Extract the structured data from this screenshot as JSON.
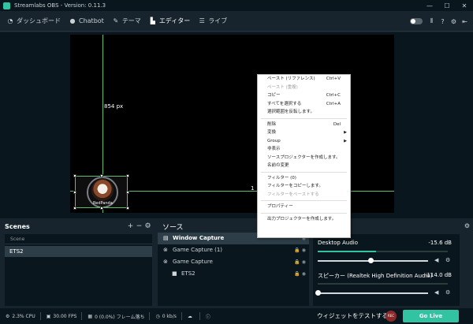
{
  "window": {
    "title": "Streamlabs OBS - Version: 0.11.3",
    "minimize": "—",
    "maximize": "☐",
    "close": "✕"
  },
  "nav": {
    "items": [
      {
        "label": "ダッシュボード",
        "icon": "dashboard-icon"
      },
      {
        "label": "Chatbot",
        "icon": "chatbot-icon"
      },
      {
        "label": "テーマ",
        "icon": "themes-icon"
      },
      {
        "label": "エディター",
        "icon": "editor-icon"
      },
      {
        "label": "ライブ",
        "icon": "live-icon"
      }
    ],
    "active": "エディター",
    "right_icons": [
      "theme-toggle-icon",
      "columns-icon",
      "help-icon",
      "settings-icon",
      "logout-icon"
    ]
  },
  "editor": {
    "distance_top": "854 px",
    "distance_right": "1",
    "source_caption": "RedPanda"
  },
  "context_menu": {
    "items": [
      {
        "label": "ペースト (リファレンス)",
        "shortcut": "Ctrl+V",
        "disabled": false
      },
      {
        "label": "ペースト (重複)",
        "shortcut": "",
        "disabled": true
      },
      {
        "label": "コピー",
        "shortcut": "Ctrl+C",
        "disabled": false
      },
      {
        "label": "すべてを選択する",
        "shortcut": "Ctrl+A",
        "disabled": false
      },
      {
        "label": "選択範囲を反転します。",
        "shortcut": "",
        "disabled": false
      },
      {
        "label": "削除",
        "shortcut": "Del",
        "disabled": false
      },
      {
        "label": "変換",
        "shortcut": "",
        "disabled": false,
        "submenu": true
      },
      {
        "label": "Group",
        "shortcut": "",
        "disabled": false,
        "submenu": true
      },
      {
        "label": "非表示",
        "shortcut": "",
        "disabled": false
      },
      {
        "label": "ソースプロジェクターを作成します。",
        "shortcut": "",
        "disabled": false
      },
      {
        "label": "名前の変更",
        "shortcut": "",
        "disabled": false
      },
      {
        "label": "フィルター (0)",
        "shortcut": "",
        "disabled": false
      },
      {
        "label": "フィルターをコピーします。",
        "shortcut": "",
        "disabled": false
      },
      {
        "label": "フィルターをペーストする",
        "shortcut": "",
        "disabled": true
      },
      {
        "label": "プロパティー",
        "shortcut": "",
        "disabled": false
      },
      {
        "label": "出力プロジェクターを作成します。",
        "shortcut": "",
        "disabled": false
      }
    ]
  },
  "scenes": {
    "title": "Scenes",
    "column_header": "Scene",
    "items": [
      "ETS2"
    ]
  },
  "sources": {
    "title": "ソース",
    "items": [
      {
        "label": "Window Capture",
        "icon": "window-capture-icon",
        "selected": true
      },
      {
        "label": "Game Capture (1)",
        "icon": "game-capture-icon",
        "selected": false
      },
      {
        "label": "Game Capture",
        "icon": "game-capture-icon",
        "selected": false
      },
      {
        "label": "ETS2",
        "icon": "folder-icon",
        "selected": false
      }
    ]
  },
  "mixer": {
    "channels": [
      {
        "name": "Desktop Audio",
        "db": "-15.6 dB",
        "level": 0.48,
        "meter": 0.45
      },
      {
        "name": "スピーカー (Realtek High Definition Audio)",
        "db": "-114.0 dB",
        "level": 0.0,
        "meter": 0.0
      }
    ]
  },
  "footer": {
    "cpu": "2.3% CPU",
    "fps": "30.00 FPS",
    "dropped": "0 (0.0%) フレーム落ち",
    "bitrate": "0 kb/s",
    "test_widgets": "ウィジェットをテストする",
    "rec_label": "REC",
    "go_live": "Go Live"
  }
}
